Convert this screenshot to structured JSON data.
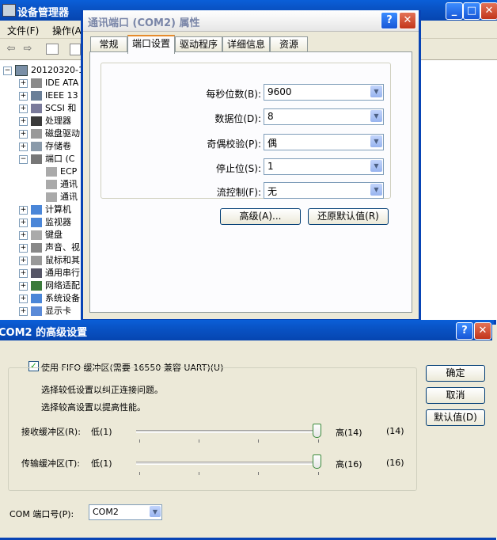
{
  "device_manager": {
    "title": "设备管理器",
    "menu": [
      "文件(F)",
      "操作(A)"
    ],
    "tree": {
      "root": "20120320-1",
      "items": [
        {
          "label": "IDE ATA",
          "expander": "+"
        },
        {
          "label": "IEEE 13",
          "expander": "+"
        },
        {
          "label": "SCSI 和",
          "expander": "+"
        },
        {
          "label": "处理器",
          "expander": "+"
        },
        {
          "label": "磁盘驱动",
          "expander": "+"
        },
        {
          "label": "存储卷",
          "expander": "+"
        },
        {
          "label": "端口 (C",
          "expander": "−"
        },
        {
          "label": "ECP",
          "child": true
        },
        {
          "label": "通讯",
          "child": true
        },
        {
          "label": "通讯",
          "child": true
        },
        {
          "label": "计算机",
          "expander": "+"
        },
        {
          "label": "监视器",
          "expander": "+"
        },
        {
          "label": "键盘",
          "expander": "+"
        },
        {
          "label": "声音、视",
          "expander": "+"
        },
        {
          "label": "鼠标和其",
          "expander": "+"
        },
        {
          "label": "通用串行",
          "expander": "+"
        },
        {
          "label": "网络适配",
          "expander": "+"
        },
        {
          "label": "系统设备",
          "expander": "+"
        },
        {
          "label": "显示卡",
          "expander": "+"
        }
      ]
    }
  },
  "properties_dialog": {
    "title": "通讯端口 (COM2) 属性",
    "help_btn": "?",
    "close_btn": "✕",
    "tabs": [
      "常规",
      "端口设置",
      "驱动程序",
      "详细信息",
      "资源"
    ],
    "fields": [
      {
        "label": "每秒位数(B):",
        "value": "9600"
      },
      {
        "label": "数据位(D):",
        "value": "8"
      },
      {
        "label": "奇偶校验(P):",
        "value": "偶"
      },
      {
        "label": "停止位(S):",
        "value": "1"
      },
      {
        "label": "流控制(F):",
        "value": "无"
      }
    ],
    "advanced_btn": "高级(A)...",
    "restore_btn": "还原默认值(R)"
  },
  "advanced_dialog": {
    "title": "COM2 的高级设置",
    "help_btn": "?",
    "close_btn": "✕",
    "fifo_label": "使用 FIFO 缓冲区(需要 16550 兼容 UART)(U)",
    "fifo_checked": true,
    "hint_low": "选择较低设置以纠正连接问题。",
    "hint_high": "选择较高设置以提高性能。",
    "rx_label": "接收缓冲区(R):",
    "rx_low": "低(1)",
    "rx_high": "高(14)",
    "rx_value": "(14)",
    "rx_level": 1.0,
    "tx_label": "传输缓冲区(T):",
    "tx_low": "低(1)",
    "tx_high": "高(16)",
    "tx_value": "(16)",
    "tx_level": 1.0,
    "com_label": "COM 端口号(P):",
    "com_value": "COM2",
    "ok_btn": "确定",
    "cancel_btn": "取消",
    "default_btn": "默认值(D)"
  }
}
